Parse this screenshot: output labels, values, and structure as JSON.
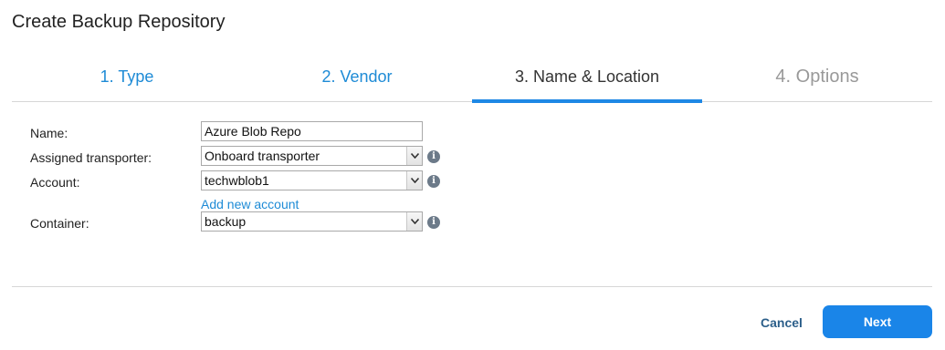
{
  "dialog": {
    "title": "Create Backup Repository"
  },
  "steps": [
    {
      "label": "1. Type",
      "state": "done"
    },
    {
      "label": "2. Vendor",
      "state": "done"
    },
    {
      "label": "3. Name & Location",
      "state": "active"
    },
    {
      "label": "4. Options",
      "state": "future"
    }
  ],
  "form": {
    "name": {
      "label": "Name:",
      "value": "Azure Blob Repo"
    },
    "transporter": {
      "label": "Assigned transporter:",
      "value": "Onboard transporter",
      "info_icon": "info-icon"
    },
    "account": {
      "label": "Account:",
      "value": "techwblob1",
      "info_icon": "info-icon"
    },
    "add_account_link": "Add new account",
    "container": {
      "label": "Container:",
      "value": "backup",
      "info_icon": "info-icon"
    }
  },
  "footer": {
    "cancel_label": "Cancel",
    "next_label": "Next"
  },
  "colors": {
    "accent": "#1a85e8",
    "link": "#1e8bd6",
    "muted": "#999999"
  }
}
